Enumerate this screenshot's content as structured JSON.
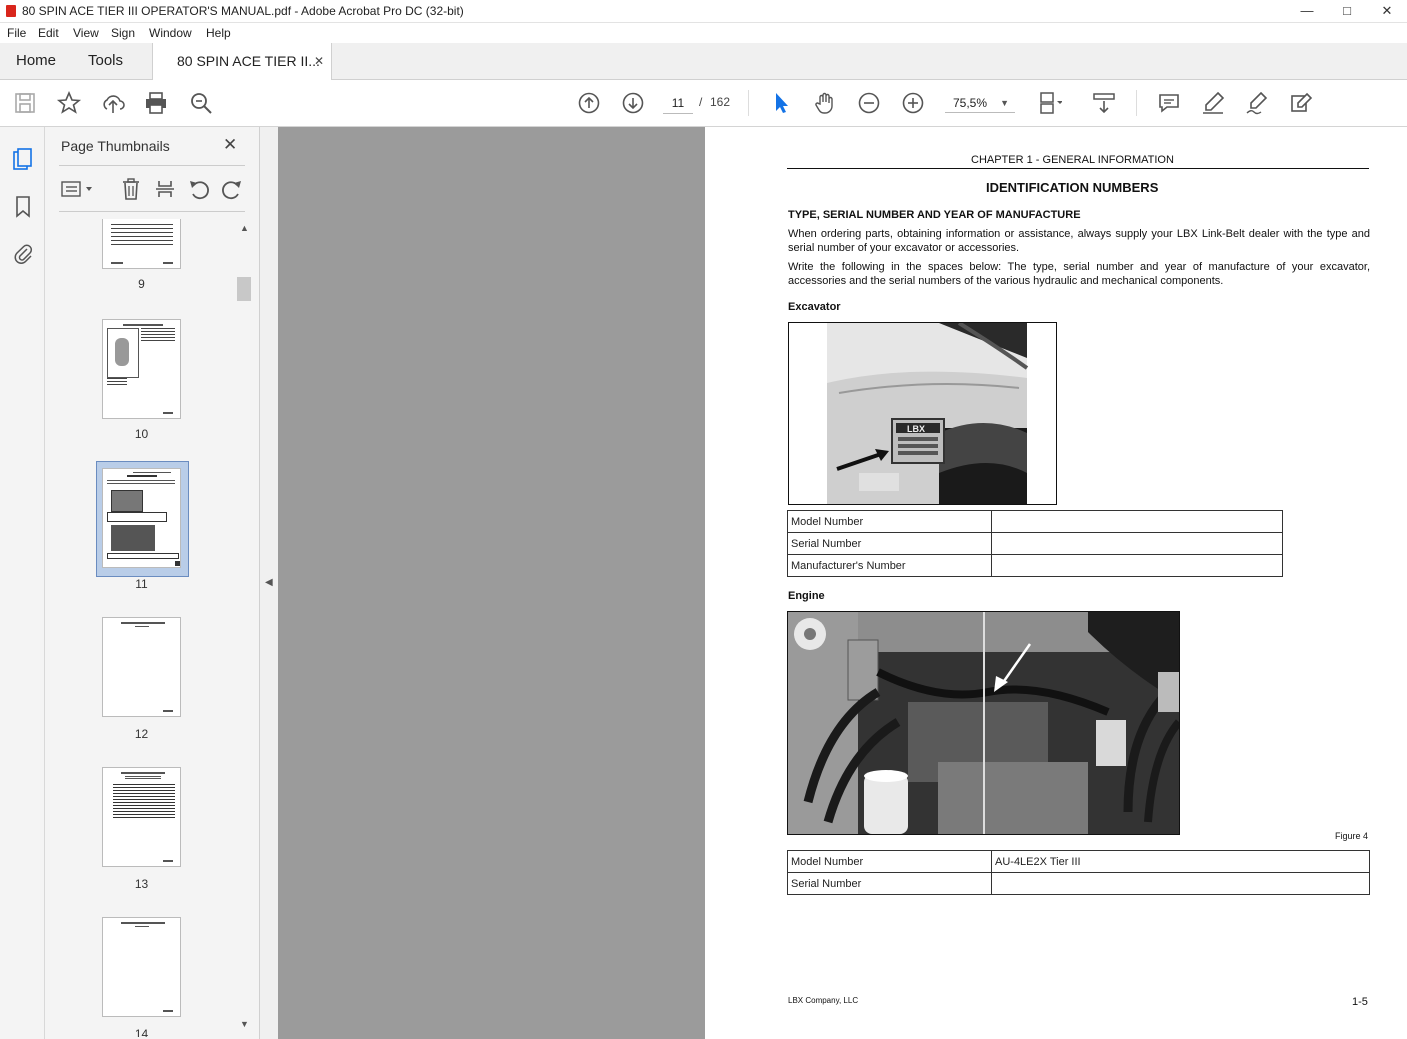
{
  "window": {
    "title": "80 SPIN ACE TIER III OPERATOR'S MANUAL.pdf - Adobe Acrobat Pro DC (32-bit)"
  },
  "menu": [
    "File",
    "Edit",
    "View",
    "Sign",
    "Window",
    "Help"
  ],
  "tabs": {
    "home": "Home",
    "tools": "Tools",
    "doc": "80 SPIN ACE TIER II..."
  },
  "toolbar": {
    "page_current": "11",
    "page_sep": "/",
    "page_total": "162",
    "zoom": "75,5%"
  },
  "thumbnails": {
    "title": "Page Thumbnails",
    "pages": [
      "9",
      "10",
      "11",
      "12",
      "13",
      "14"
    ],
    "selected": "11"
  },
  "doc": {
    "chapter": "CHAPTER 1 - GENERAL INFORMATION",
    "heading": "IDENTIFICATION NUMBERS",
    "subheading": "TYPE, SERIAL NUMBER AND YEAR OF MANUFACTURE",
    "para1": "When ordering parts, obtaining information or assistance, always supply your LBX Link-Belt dealer with the type and serial number of your excavator or accessories.",
    "para2": "Write the following in the spaces below: The type, serial number and year of manufacture of your excavator, accessories and the serial numbers of the various hydraulic and mechanical components.",
    "excavator_label": "Excavator",
    "excavator_table": [
      {
        "label": "Model Number",
        "value": ""
      },
      {
        "label": "Serial Number",
        "value": ""
      },
      {
        "label": "Manufacturer's Number",
        "value": ""
      }
    ],
    "engine_label": "Engine",
    "figure_caption": "Figure 4",
    "engine_table": [
      {
        "label": "Model Number",
        "value": "AU-4LE2X Tier III"
      },
      {
        "label": "Serial Number",
        "value": ""
      }
    ],
    "plate_text": "LBX",
    "footer_company": "LBX Company, LLC",
    "footer_page": "1-5"
  },
  "colors": {
    "accent_blue": "#1473e6",
    "gray_bg": "#9b9b9b",
    "pdf_red": "#d9261c"
  }
}
